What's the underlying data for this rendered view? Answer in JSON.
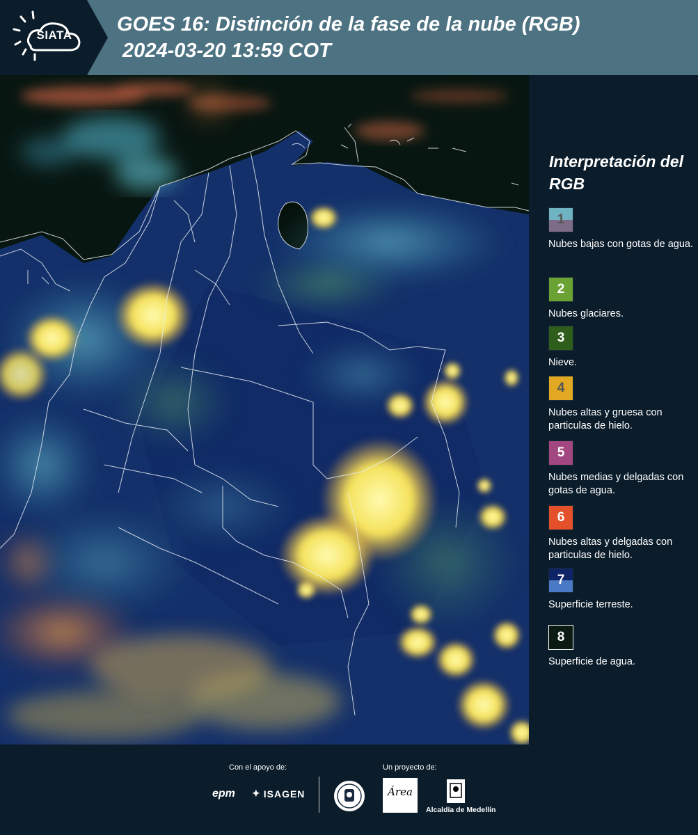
{
  "header": {
    "logo_text": "SIATA",
    "title_line1": "GOES 16: Distinción de la fase de la nube (RGB)",
    "title_line2": " 2024-03-20 13:59 COT",
    "background_color": "#4d7282"
  },
  "legend": {
    "title": "Interpretación del RGB",
    "items": [
      {
        "number": "1",
        "label": "Nubes bajas con gotas de agua.",
        "color_top": "#6fb2c1",
        "color_bottom": "#7e6b87",
        "number_color": "#555555"
      },
      {
        "number": "2",
        "label": "Nubes glaciares.",
        "color_top": "#6aa233",
        "color_bottom": "#6aa233",
        "number_color": "#ffffff"
      },
      {
        "number": "3",
        "label": "Nieve.",
        "color_top": "#2f5e1c",
        "color_bottom": "#2f5e1c",
        "number_color": "#ffffff"
      },
      {
        "number": "4",
        "label": "Nubes altas y gruesa con particulas de hielo.",
        "color_top": "#e2a822",
        "color_bottom": "#e2a822",
        "number_color": "#555555"
      },
      {
        "number": "5",
        "label": "Nubes medias y delgadas con gotas de agua.",
        "color_top": "#a2477f",
        "color_bottom": "#a2477f",
        "number_color": "#ffffff"
      },
      {
        "number": "6",
        "label": "Nubes altas y delgadas con particulas de hielo.",
        "color_top": "#e4502a",
        "color_bottom": "#e4502a",
        "number_color": "#ffffff"
      },
      {
        "number": "7",
        "label": "Superficie terreste.",
        "color_top": "#0e2467",
        "color_bottom": "#4a7ac6",
        "number_color": "#ffffff"
      },
      {
        "number": "8",
        "label": "Superficie de agua.",
        "color_top": "#0b1a12",
        "color_bottom": "#0b1a12",
        "number_color": "#ffffff"
      }
    ]
  },
  "footer": {
    "support_label": "Con el apoyo de:",
    "project_label": "Un proyecto de:",
    "epm": "epm",
    "isagen": "ISAGEN",
    "area_metropolitana": "Área",
    "alcaldia": "Alcaldía de Medellín"
  }
}
